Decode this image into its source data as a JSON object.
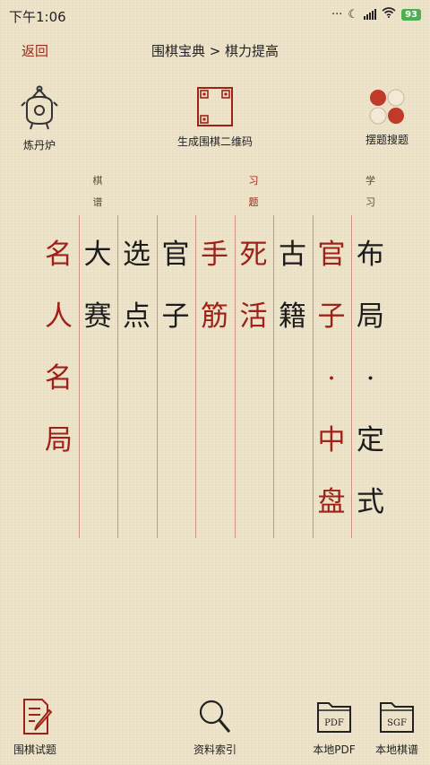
{
  "status": {
    "time": "下午1:06",
    "battery": "93",
    "icons": [
      "dots-icon",
      "moon-icon",
      "signal-icon",
      "wifi-icon",
      "battery-icon"
    ]
  },
  "nav": {
    "back_label": "返回",
    "title": "围棋宝典 > 棋力提高"
  },
  "toolbar": {
    "left_label": "炼丹炉",
    "center_label": "生成围棋二维码",
    "right_label": "摆题搜题"
  },
  "columns": [
    {
      "small": "学\n习",
      "main": "布\n局\n·\n定\n式",
      "color": "#1c1c1c",
      "small_color": "#5a4a30"
    },
    {
      "small": "",
      "main": "官\n子\n·\n中\n盘",
      "color": "#9e2218",
      "small_color": "#9e2218"
    },
    {
      "small": "",
      "main": "古\n籍",
      "color": "#1c1c1c",
      "small_color": "#5a4a30"
    },
    {
      "small": "习\n题",
      "main": "死\n活",
      "color": "#9e2218",
      "small_color": "#9e2218"
    },
    {
      "small": "",
      "main": "手\n筋",
      "color": "#9e2218",
      "small_color": "#9e2218"
    },
    {
      "small": "",
      "main": "官\n子",
      "color": "#1c1c1c",
      "small_color": "#5a4a30"
    },
    {
      "small": "",
      "main": "选\n点",
      "color": "#1c1c1c",
      "small_color": "#5a4a30"
    },
    {
      "small": "棋\n谱",
      "main": "大\n赛",
      "color": "#1c1c1c",
      "small_color": "#5a4a30"
    },
    {
      "small": "",
      "main": "名\n人\n名\n局",
      "color": "#9e2218",
      "small_color": "#9e2218"
    }
  ],
  "bottom": {
    "item1": "围棋试题",
    "item2": "资料索引",
    "item3": "本地PDF",
    "item4": "本地棋谱",
    "pdf_text": "PDF",
    "sgf_text": "SGF"
  },
  "colors": {
    "background": "#ede4cb",
    "accent_red": "#9e2218",
    "text_dark": "#1c1c1c"
  }
}
